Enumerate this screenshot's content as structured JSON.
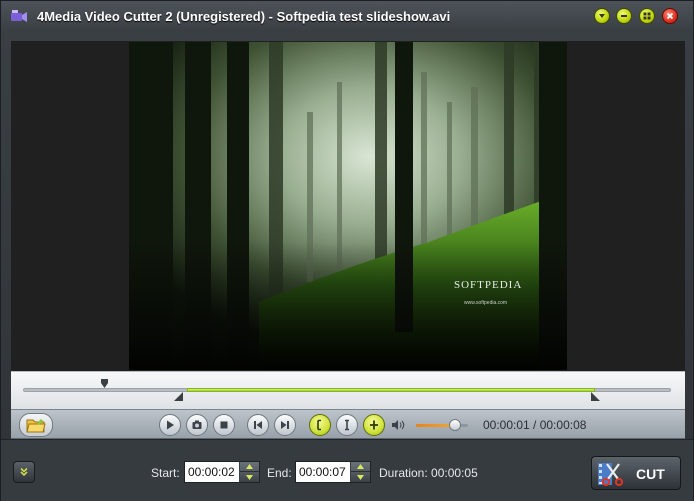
{
  "window": {
    "title": "4Media Video Cutter 2 (Unregistered) - Softpedia test slideshow.avi",
    "buttons": [
      "menu-dropdown",
      "minimize",
      "maximize",
      "close"
    ]
  },
  "video": {
    "watermark_text": "SOFTPEDIA",
    "watermark_sub": "www.softpedia.com"
  },
  "timeline": {
    "playhead_fraction": 0.11,
    "selection_start_fraction": 0.25,
    "selection_end_fraction": 0.875
  },
  "controls": {
    "open_icon": "open-folder-icon",
    "play_icon": "play-icon",
    "snapshot_icon": "snapshot-icon",
    "stop_icon": "stop-icon",
    "prev_frame_icon": "previous-frame-icon",
    "next_frame_icon": "next-frame-icon",
    "set_start_icon": "set-start-icon",
    "set_current_icon": "set-current-icon",
    "set_end_icon": "set-end-icon",
    "volume_level": 0.75,
    "current_time": "00:00:01",
    "separator": "/",
    "total_time": "00:00:08",
    "timecode_text": "00:00:01 / 00:00:08"
  },
  "bottom": {
    "start_label": "Start:",
    "start_value": "00:00:02",
    "end_label": "End:",
    "end_value": "00:00:07",
    "duration_label": "Duration:",
    "duration_value": "00:00:05",
    "duration_text": "Duration: 00:00:05",
    "cut_label": "CUT"
  },
  "colors": {
    "accent_green": "#9bd12b",
    "volume_orange": "#e8841b",
    "close_red": "#e53322"
  }
}
